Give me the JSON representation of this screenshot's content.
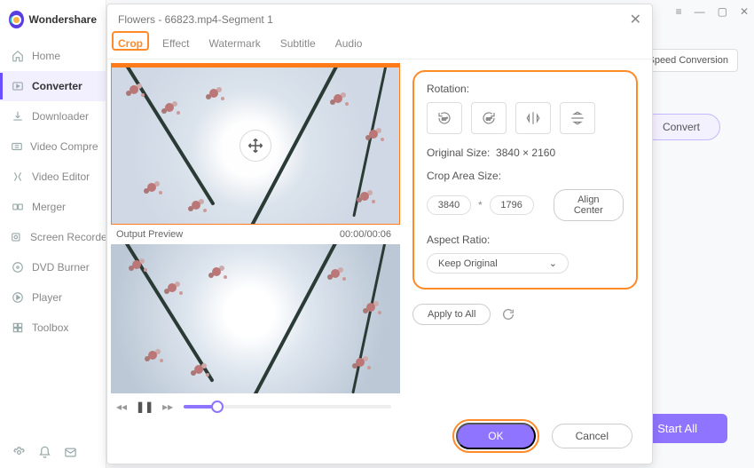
{
  "app": {
    "name": "Wondershare"
  },
  "sidebar": {
    "items": [
      {
        "label": "Home",
        "icon": "home-icon"
      },
      {
        "label": "Converter",
        "icon": "converter-icon"
      },
      {
        "label": "Downloader",
        "icon": "downloader-icon"
      },
      {
        "label": "Video Compre",
        "icon": "compress-icon"
      },
      {
        "label": "Video Editor",
        "icon": "editor-icon"
      },
      {
        "label": "Merger",
        "icon": "merger-icon"
      },
      {
        "label": "Screen Recorde",
        "icon": "record-icon"
      },
      {
        "label": "DVD Burner",
        "icon": "dvd-icon"
      },
      {
        "label": "Player",
        "icon": "player-icon"
      },
      {
        "label": "Toolbox",
        "icon": "toolbox-icon"
      }
    ],
    "active_index": 1
  },
  "header": {
    "speed_conversion": "Speed Conversion",
    "convert": "Convert",
    "start_all": "Start All"
  },
  "modal": {
    "title": "Flowers - 66823.mp4-Segment 1",
    "tabs": [
      "Crop",
      "Effect",
      "Watermark",
      "Subtitle",
      "Audio"
    ],
    "active_tab": 0,
    "preview_label": "Output Preview",
    "time": "00:00/00:06",
    "rotation_label": "Rotation:",
    "original_size_label": "Original Size:",
    "original_size_value": "3840 × 2160",
    "crop_area_label": "Crop Area Size:",
    "crop_w": "3840",
    "crop_h": "1796",
    "align_center": "Align Center",
    "aspect_label": "Aspect Ratio:",
    "aspect_value": "Keep Original",
    "apply_all": "Apply to All",
    "ok": "OK",
    "cancel": "Cancel"
  }
}
